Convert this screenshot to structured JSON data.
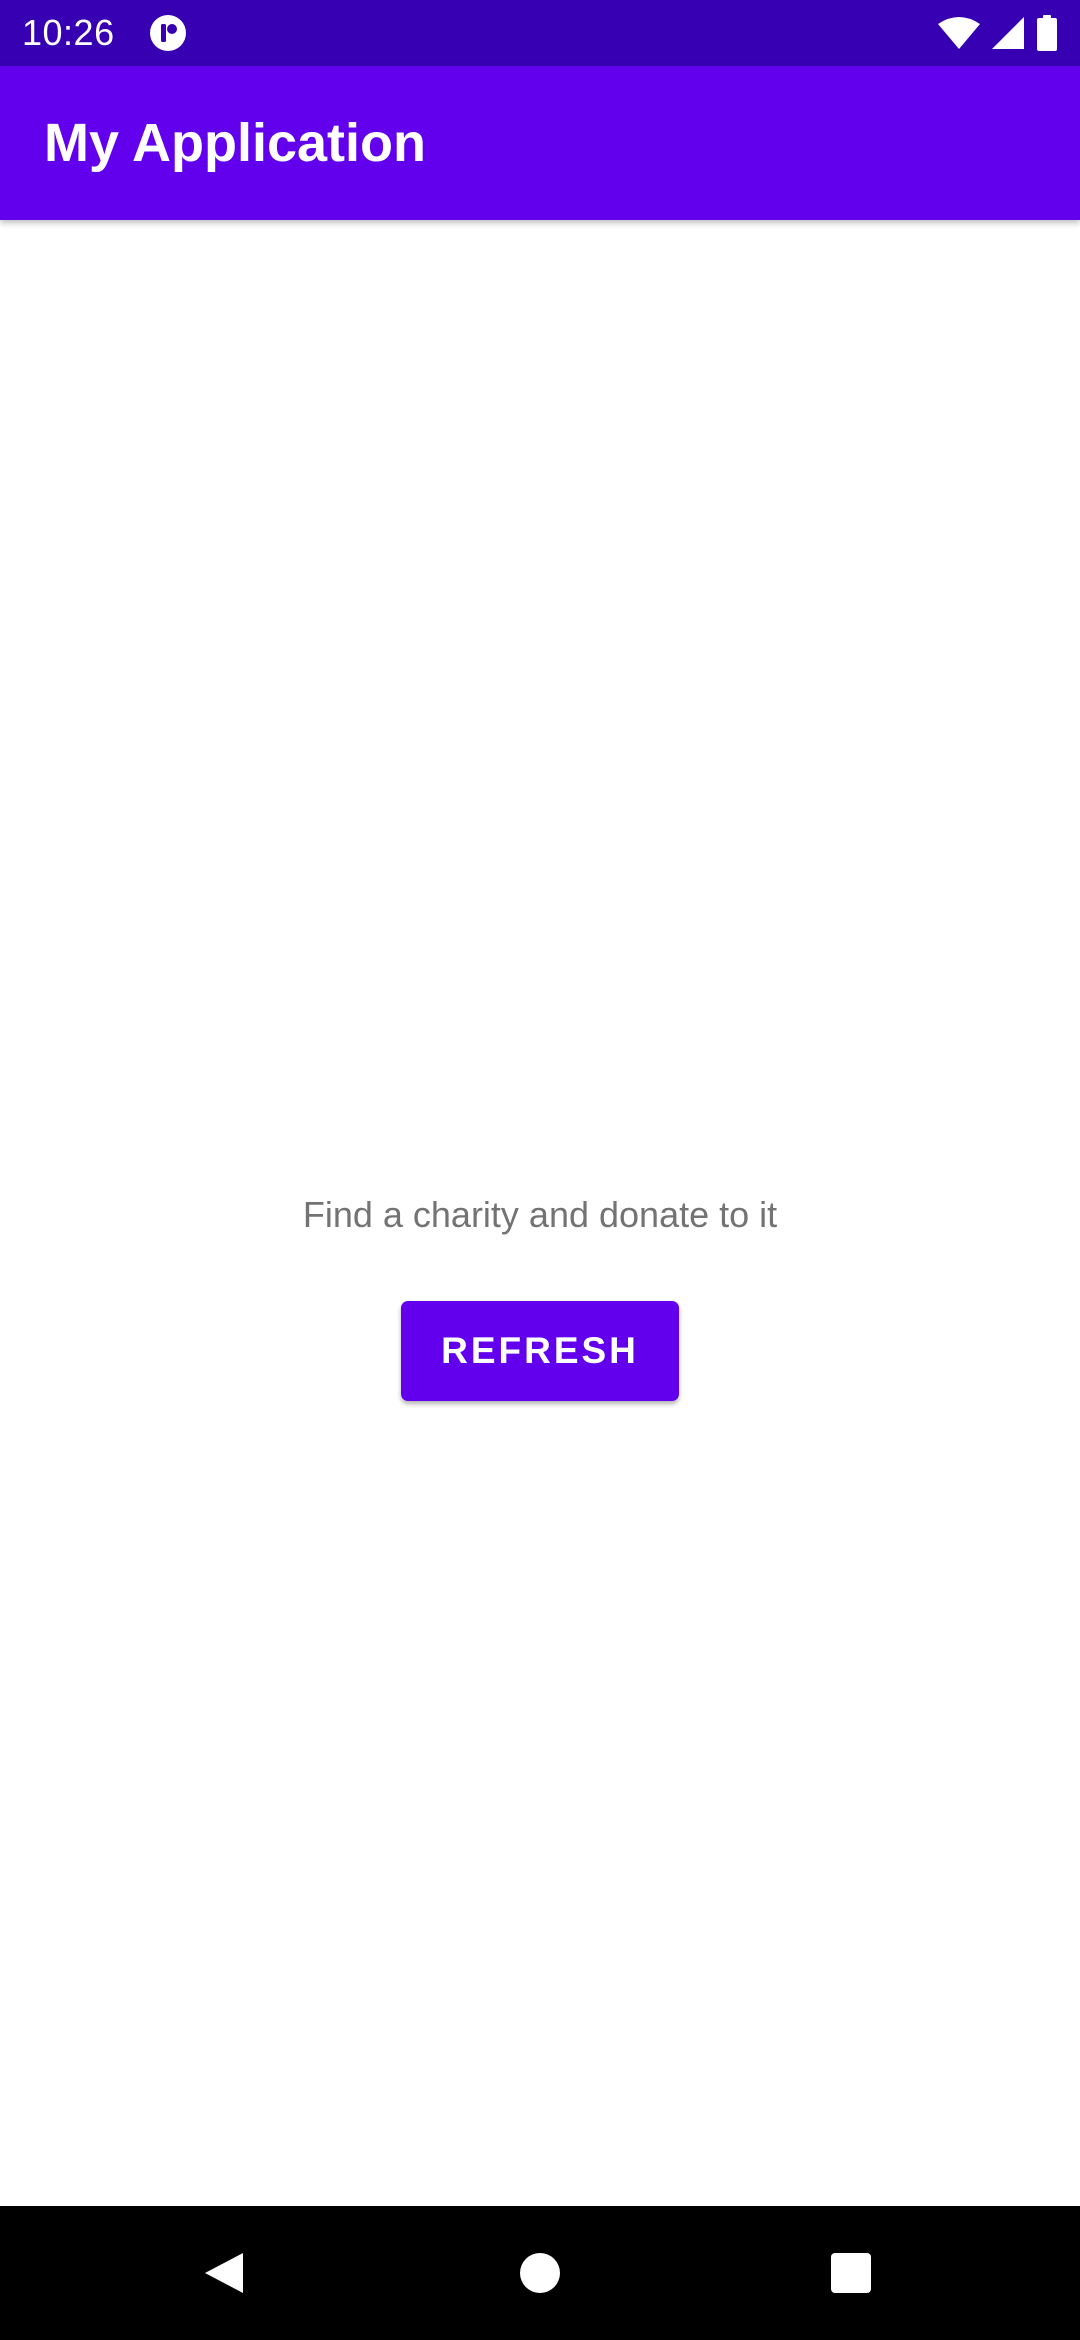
{
  "status_bar": {
    "time": "10:26",
    "icons": [
      "app-notification-icon",
      "wifi-icon",
      "cellular-signal-icon",
      "battery-icon"
    ]
  },
  "app_bar": {
    "title": "My Application"
  },
  "main": {
    "message": "Find a charity and donate to it",
    "refresh_label": "REFRESH"
  },
  "nav_bar": {
    "icons": [
      "back-icon",
      "home-icon",
      "recents-icon"
    ]
  },
  "colors": {
    "status_bar": "#3700b3",
    "primary": "#6200ee",
    "message_text": "#737373",
    "background": "#ffffff",
    "nav_bar": "#000000"
  }
}
